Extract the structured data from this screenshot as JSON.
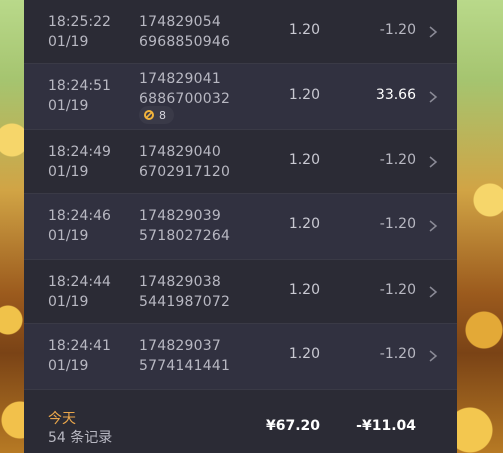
{
  "rows": [
    {
      "time": "18:25:22",
      "date": "01/19",
      "id_line1": "174829054",
      "id_line2": "6968850946",
      "bet": "1.20",
      "pl": "-1.20"
    },
    {
      "time": "18:24:51",
      "date": "01/19",
      "id_line1": "174829041",
      "id_line2": "6886700032",
      "bet": "1.20",
      "pl": "33.66",
      "badge": "8"
    },
    {
      "time": "18:24:49",
      "date": "01/19",
      "id_line1": "174829040",
      "id_line2": "6702917120",
      "bet": "1.20",
      "pl": "-1.20"
    },
    {
      "time": "18:24:46",
      "date": "01/19",
      "id_line1": "174829039",
      "id_line2": "5718027264",
      "bet": "1.20",
      "pl": "-1.20"
    },
    {
      "time": "18:24:44",
      "date": "01/19",
      "id_line1": "174829038",
      "id_line2": "5441987072",
      "bet": "1.20",
      "pl": "-1.20"
    },
    {
      "time": "18:24:41",
      "date": "01/19",
      "id_line1": "174829037",
      "id_line2": "5774141441",
      "bet": "1.20",
      "pl": "-1.20"
    }
  ],
  "footer": {
    "period": "今天",
    "records": "54 条记录",
    "total_bet": "¥67.20",
    "total_pl": "-¥11.04"
  },
  "colors": {
    "panel_bg": "#2b2b35",
    "row_alt_bg": "#313140",
    "accent": "#e9a64b",
    "text": "#b8b8c2",
    "win": "#ffffff"
  },
  "icons": {
    "row_action": "chevron-right-icon",
    "badge": "free-spin-icon"
  }
}
